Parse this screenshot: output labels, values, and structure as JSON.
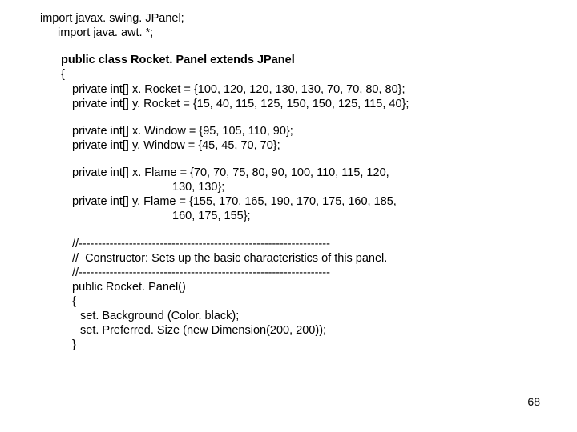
{
  "code": {
    "importSwing": "import javax. swing. JPanel;",
    "importAwt": "import java. awt. *;",
    "classDecl": "public class Rocket. Panel extends JPanel",
    "openBrace": "{",
    "xRocket": "private int[] x. Rocket = {100, 120, 120, 130, 130, 70, 70, 80, 80};",
    "yRocket": "private int[] y. Rocket = {15, 40, 115, 125, 150, 150, 125, 115, 40};",
    "xWindow": "private int[] x. Window = {95, 105, 110, 90};",
    "yWindow": "private int[] y. Window = {45, 45, 70, 70};",
    "xFlame1": "private int[] x. Flame = {70, 70, 75, 80, 90, 100, 110, 115, 120,",
    "xFlame2": "130, 130};",
    "yFlame1": "private int[] y. Flame = {155, 170, 165, 190, 170, 175, 160, 185,",
    "yFlame2": "160, 175, 155};",
    "sep1": "//-----------------------------------------------------------------",
    "comment": "//  Constructor: Sets up the basic characteristics of this panel.",
    "sep2": "//-----------------------------------------------------------------",
    "ctor": "public Rocket. Panel()",
    "ctorOpen": "{",
    "setBg": "set. Background (Color. black);",
    "setPref": "set. Preferred. Size (new Dimension(200, 200));",
    "ctorClose": "}"
  },
  "pageNumber": "68"
}
